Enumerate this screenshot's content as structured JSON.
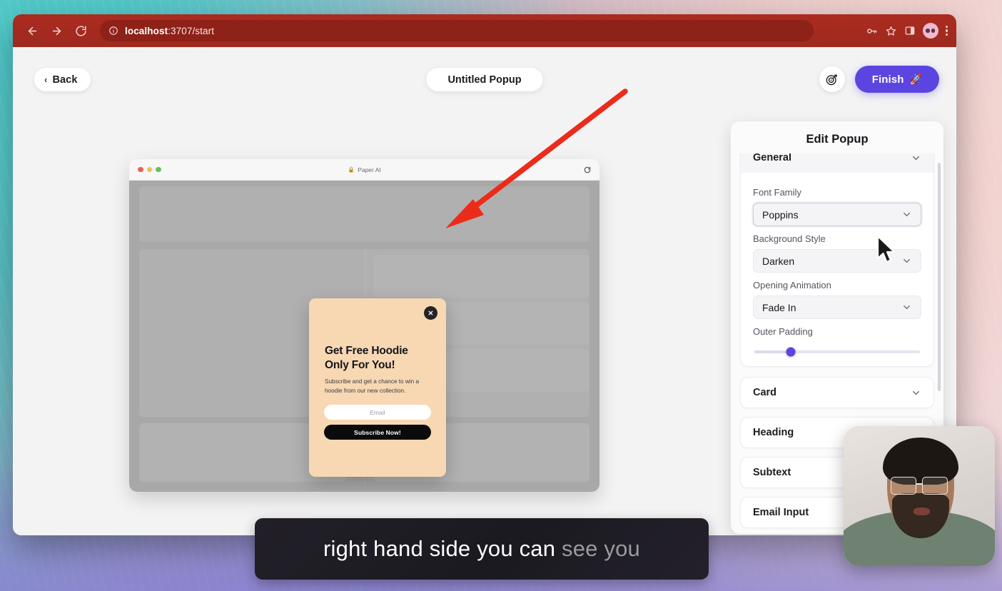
{
  "browser": {
    "url_prefix": "localhost",
    "url_suffix": ":3707/start",
    "nav": {
      "back": "back-arrow",
      "forward": "forward-arrow",
      "reload": "reload-icon",
      "site_info": "info-icon"
    },
    "actions": {
      "passwords": "key-icon",
      "bookmark": "star-icon",
      "side_panel": "side-panel-icon",
      "profile": "profile-avatar",
      "menu": "kebab-menu-icon"
    }
  },
  "app": {
    "back_label": "Back",
    "document_title": "Untitled Popup",
    "target_icon": "target-icon",
    "finish_label": "Finish",
    "finish_emoji": "🚀",
    "accent_color": "#5b45e0"
  },
  "preview": {
    "site_bar": {
      "lock": "🔒",
      "title": "Paper AI",
      "reload_icon": "reload-icon"
    },
    "popup": {
      "close_icon": "close-icon",
      "heading": "Get Free Hoodie Only For You!",
      "subtext": "Subscribe and get a chance to win a hoodie from our new collection.",
      "email_placeholder": "Email",
      "cta_label": "Subscribe Now!",
      "card_color": "#f7d8b3",
      "cta_color": "#0b0b0c"
    }
  },
  "panel": {
    "title": "Edit Popup",
    "general_section": {
      "header": "General",
      "fields": [
        {
          "label": "Font Family",
          "value": "Poppins"
        },
        {
          "label": "Background Style",
          "value": "Darken"
        },
        {
          "label": "Opening Animation",
          "value": "Fade In"
        }
      ],
      "slider": {
        "label": "Outer Padding",
        "percent": 22
      }
    },
    "collapsed_sections": [
      {
        "label": "Card"
      },
      {
        "label": "Heading"
      },
      {
        "label": "Subtext"
      },
      {
        "label": "Email Input"
      }
    ]
  },
  "caption": {
    "spoken": "right hand side you can",
    "upcoming": "see you"
  },
  "annotation": {
    "arrow_color": "#ec2b1a"
  }
}
